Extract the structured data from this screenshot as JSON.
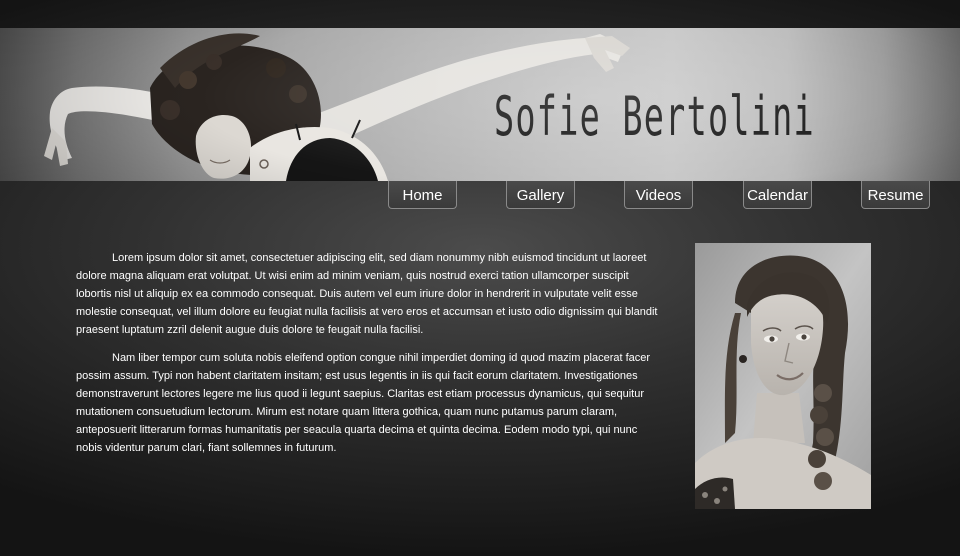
{
  "header": {
    "site_title": "Sofie Bertolini"
  },
  "nav": {
    "items": [
      {
        "label": "Home"
      },
      {
        "label": "Gallery"
      },
      {
        "label": "Videos"
      },
      {
        "label": "Calendar"
      },
      {
        "label": "Resume"
      }
    ]
  },
  "main": {
    "paragraphs": [
      "Lorem ipsum dolor sit amet, consectetuer adipiscing elit, sed diam nonummy nibh euismod tincidunt ut laoreet dolore magna aliquam erat volutpat. Ut wisi enim ad minim veniam, quis nostrud exerci tation ullamcorper suscipit lobortis nisl ut aliquip ex ea commodo consequat. Duis autem vel eum iriure dolor in hendrerit in vulputate velit esse molestie consequat, vel illum dolore eu feugiat nulla facilisis at vero eros et accumsan et iusto odio dignissim qui blandit praesent luptatum zzril delenit augue duis dolore te feugait nulla facilisi.",
      "Nam liber tempor cum soluta nobis eleifend option congue nihil imperdiet doming id quod mazim placerat facer possim assum. Typi non habent claritatem insitam; est usus legentis in iis qui facit eorum claritatem. Investigationes demonstraverunt lectores legere me lius quod ii legunt saepius. Claritas est etiam processus dynamicus, qui sequitur mutationem consuetudium lectorum. Mirum est notare quam littera gothica, quam nunc putamus parum claram, anteposuerit litterarum formas humanitatis per seacula quarta decima et quinta decima. Eodem modo typi, qui nunc nobis videntur parum clari, fiant sollemnes in futurum."
    ]
  },
  "colors": {
    "page_background": "#2b2b2b",
    "text": "#ffffff",
    "nav_border": "#8a8a8a",
    "title_ink": "#161616"
  }
}
